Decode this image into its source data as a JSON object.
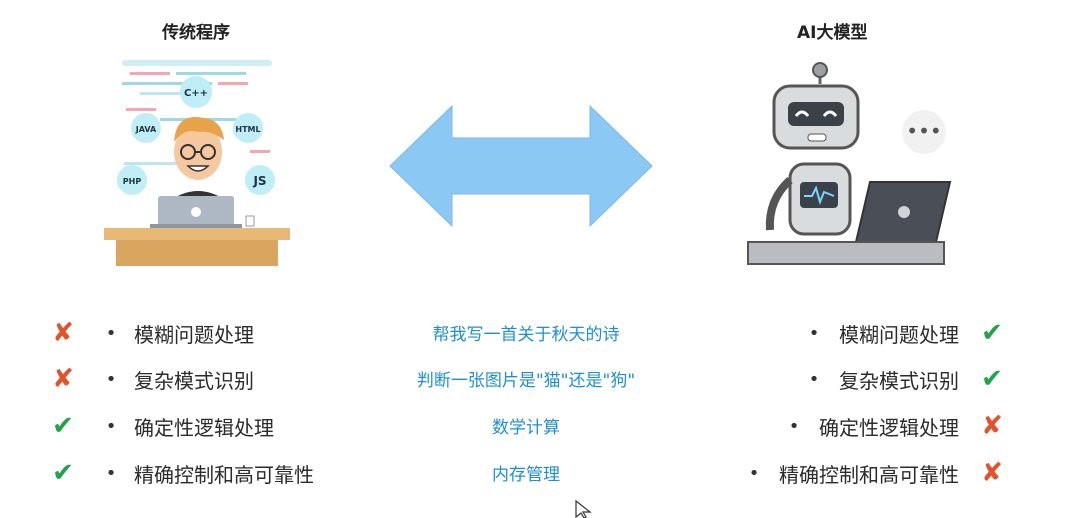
{
  "left_title": "传统程序",
  "right_title": "AI大模型",
  "left_badges": [
    "C++",
    "JAVA",
    "HTML",
    "PHP",
    "JS"
  ],
  "thinking_dots": "•••",
  "left_list": [
    {
      "mark": "✘",
      "status": "cross",
      "text": "模糊问题处理"
    },
    {
      "mark": "✘",
      "status": "cross",
      "text": "复杂模式识别"
    },
    {
      "mark": "✔",
      "status": "check",
      "text": "确定性逻辑处理"
    },
    {
      "mark": "✔",
      "status": "check",
      "text": "精确控制和高可靠性"
    }
  ],
  "middle_list": [
    "帮我写一首关于秋天的诗",
    "判断一张图片是\"猫\"还是\"狗\"",
    "数学计算",
    "内存管理"
  ],
  "right_list": [
    {
      "mark": "✔",
      "status": "check",
      "text": "模糊问题处理"
    },
    {
      "mark": "✔",
      "status": "check",
      "text": "复杂模式识别"
    },
    {
      "mark": "✘",
      "status": "cross",
      "text": "确定性逻辑处理"
    },
    {
      "mark": "✘",
      "status": "cross",
      "text": "精确控制和高可靠性"
    }
  ],
  "bullet": "•",
  "colors": {
    "arrow": "#8cc8f4",
    "cross": "#e2532c",
    "check": "#22a34a",
    "middle_text": "#1e8fd6"
  }
}
